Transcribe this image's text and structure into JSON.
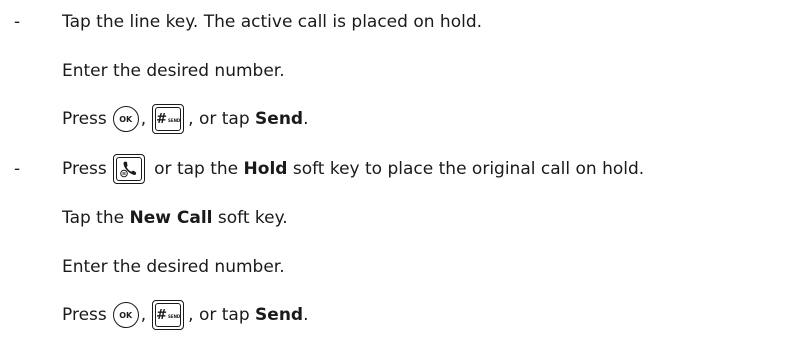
{
  "steps": {
    "method1": {
      "bullet": "-",
      "line1": "Tap the line key. The active call is placed on hold.",
      "line2": "Enter the desired number.",
      "line3_prefix": "Press",
      "line3_comma": ",",
      "line3_or": ", or tap ",
      "line3_send": "Send",
      "line3_period": "."
    },
    "method2": {
      "bullet": "-",
      "line1_prefix": "Press",
      "line1_mid": " or tap the ",
      "line1_hold": "Hold",
      "line1_suffix": " soft key to place the original call on hold.",
      "line2_prefix": "Tap the ",
      "line2_newcall": "New Call",
      "line2_suffix": " soft key.",
      "line3": "Enter the desired number.",
      "line4_prefix": "Press",
      "line4_comma": ",",
      "line4_or": ", or tap ",
      "line4_send": "Send",
      "line4_period": "."
    }
  },
  "keys": {
    "ok_label": "OK",
    "send_hash": "#",
    "send_label": "SEND"
  },
  "icons": {
    "ok_key": "ok-key-icon",
    "send_key": "send-key-icon",
    "hold_key": "hold-key-icon"
  }
}
